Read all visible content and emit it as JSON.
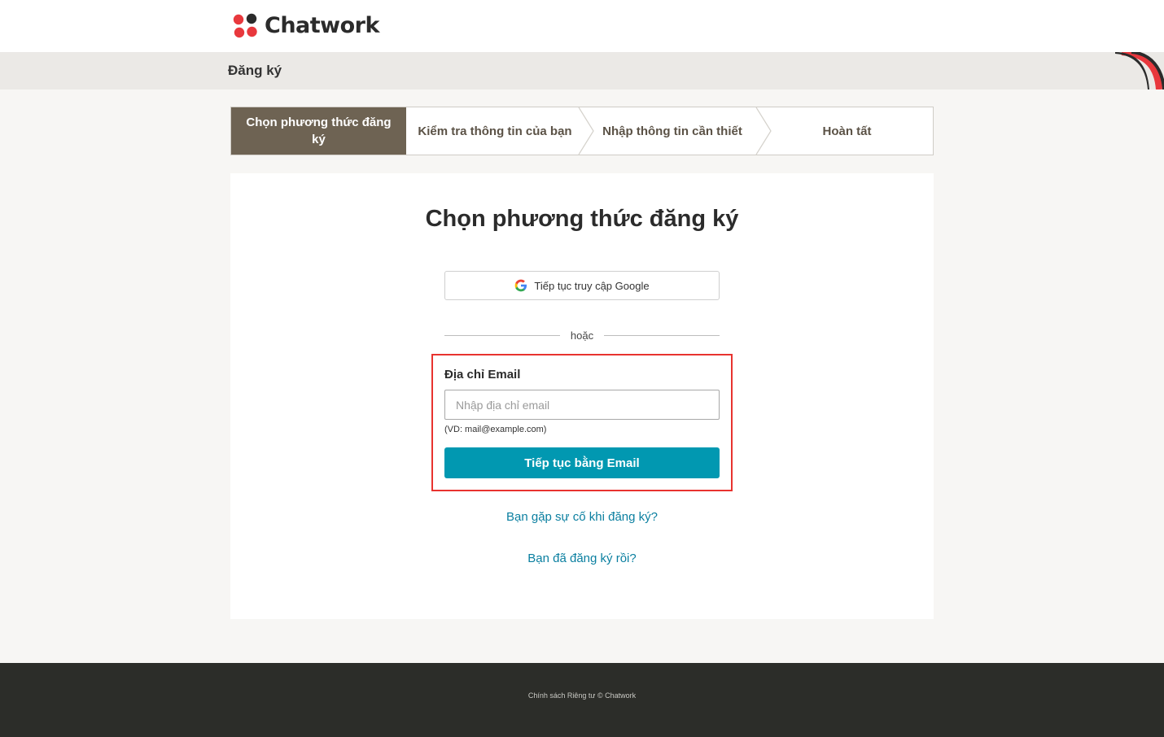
{
  "brand": {
    "name": "Chatwork",
    "colors": {
      "red": "#e8383d",
      "dark": "#2b2b2b",
      "accent": "#0198b1"
    }
  },
  "subbar": {
    "title": "Đăng ký"
  },
  "stepper": {
    "steps": [
      {
        "label": "Chọn phương thức đăng ký",
        "active": true
      },
      {
        "label": "Kiểm tra thông tin của bạn",
        "active": false
      },
      {
        "label": "Nhập thông tin cần thiết",
        "active": false
      },
      {
        "label": "Hoàn tất",
        "active": false
      }
    ]
  },
  "card": {
    "title": "Chọn phương thức đăng ký",
    "google_button": {
      "label": "Tiếp tục truy cập Google",
      "icon": "google-icon"
    },
    "divider_text": "hoặc",
    "email": {
      "label": "Địa chỉ Email",
      "placeholder": "Nhập địa chỉ email",
      "value": "",
      "hint": "(VD: mail@example.com)",
      "submit_label": "Tiếp tục bằng Email"
    },
    "links": {
      "trouble": "Bạn gặp sự cố khi đăng ký?",
      "registered": "Bạn đã đăng ký rồi?"
    }
  },
  "footer": {
    "privacy": "Chính sách Riêng tư",
    "copyright": "© Chatwork"
  }
}
